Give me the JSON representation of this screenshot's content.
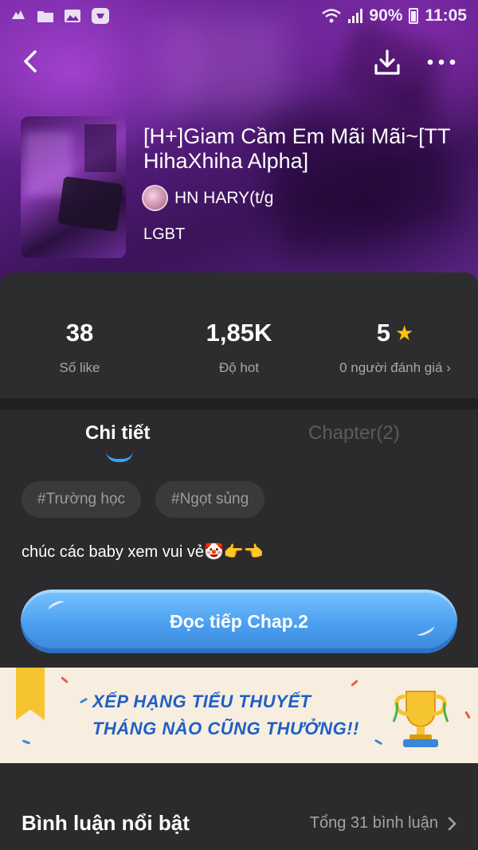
{
  "status_bar": {
    "battery": "90%",
    "time": "11:05"
  },
  "book": {
    "title": "[H+]Giam Cầm Em Mãi Mãi~[TT HihaXhiha Alpha]",
    "author": "HN HARY(t/g",
    "genre": "LGBT"
  },
  "stats": [
    {
      "value": "38",
      "label": "Số like"
    },
    {
      "value": "1,85K",
      "label": "Độ hot"
    },
    {
      "value": "5",
      "label": "0 người đánh giá"
    }
  ],
  "tabs": {
    "detail": "Chi tiết",
    "chapter": "Chapter(2)"
  },
  "tags": [
    "#Trường học",
    "#Ngọt sủng"
  ],
  "description": "chúc các baby xem vui vẻ🤡👉👈",
  "cta": {
    "label": "Đọc tiếp Chap.2"
  },
  "banner": {
    "line1": "XẾP HẠNG TIỂU THUYẾT",
    "line2": "THÁNG NÀO CŨNG THƯỞNG!!"
  },
  "comments": {
    "title": "Bình luận nổi bật",
    "total": "Tổng 31 bình luận"
  },
  "colors": {
    "accent": "#2ea8f5",
    "star": "#ffc107",
    "cta": "#4b9ff0",
    "banner_text": "#1f5fc7"
  },
  "icons": [
    "notification-icon",
    "folder-icon",
    "image-icon",
    "app-icon",
    "wifi-icon",
    "signal-icon",
    "battery-icon",
    "back-icon",
    "download-icon",
    "more-icon",
    "star-icon",
    "chevron-right-icon",
    "trophy-icon"
  ]
}
